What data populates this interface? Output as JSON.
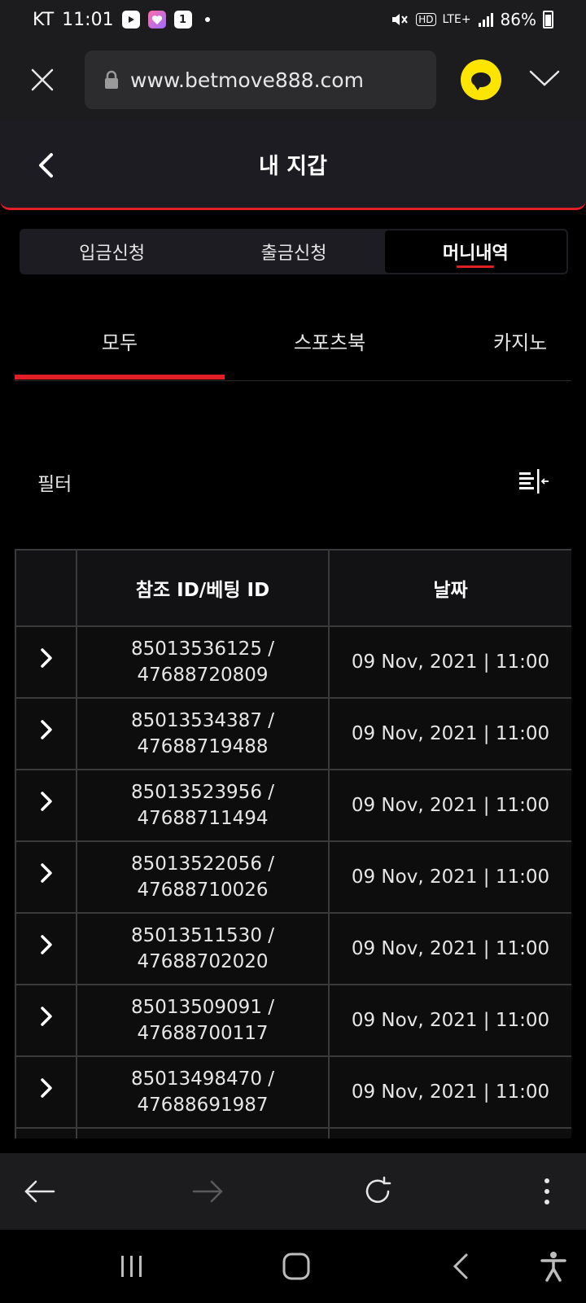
{
  "status_bar": {
    "carrier": "KT",
    "time": "11:01",
    "notif_badge": "1",
    "network": "LTE+",
    "battery": "86%"
  },
  "browser": {
    "url": "www.betmove888.com"
  },
  "header": {
    "title": "내 지갑"
  },
  "wallet_tabs": [
    {
      "label": "입금신청",
      "active": false
    },
    {
      "label": "출금신청",
      "active": false
    },
    {
      "label": "머니내역",
      "active": true
    }
  ],
  "category_tabs": [
    {
      "label": "모두",
      "active": true
    },
    {
      "label": "스포츠북",
      "active": false
    },
    {
      "label": "카지노",
      "active": false
    }
  ],
  "filter": {
    "label": "필터"
  },
  "table": {
    "columns": [
      "",
      "참조 ID/베팅 ID",
      "날짜"
    ],
    "rows": [
      {
        "ref_id": "85013536125 /",
        "bet_id": "47688720809",
        "date": "09 Nov, 2021 | 11:00"
      },
      {
        "ref_id": "85013534387 /",
        "bet_id": "47688719488",
        "date": "09 Nov, 2021 | 11:00"
      },
      {
        "ref_id": "85013523956 /",
        "bet_id": "47688711494",
        "date": "09 Nov, 2021 | 11:00"
      },
      {
        "ref_id": "85013522056 /",
        "bet_id": "47688710026",
        "date": "09 Nov, 2021 | 11:00"
      },
      {
        "ref_id": "85013511530 /",
        "bet_id": "47688702020",
        "date": "09 Nov, 2021 | 11:00"
      },
      {
        "ref_id": "85013509091 /",
        "bet_id": "47688700117",
        "date": "09 Nov, 2021 | 11:00"
      },
      {
        "ref_id": "85013498470 /",
        "bet_id": "47688691987",
        "date": "09 Nov, 2021 | 11:00"
      },
      {
        "ref_id": "",
        "bet_id": "",
        "date": ""
      }
    ]
  },
  "colors": {
    "accent": "#e01e26",
    "kakao": "#fee500",
    "surface": "#1c1c22"
  }
}
